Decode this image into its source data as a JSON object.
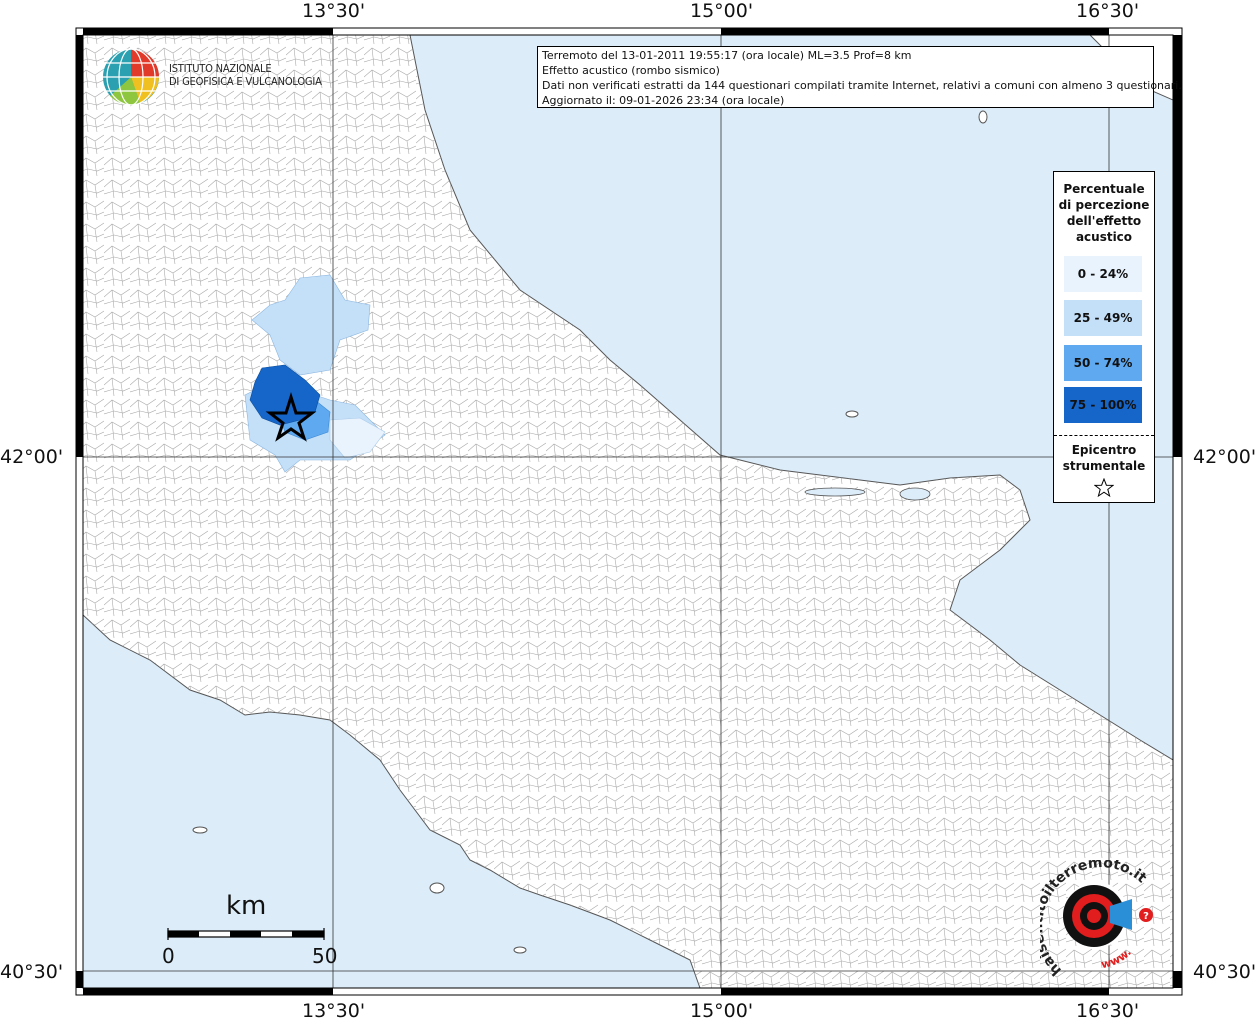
{
  "map": {
    "grid": {
      "lon_labels": [
        "13°30'",
        "15°00'",
        "16°30'"
      ],
      "lat_labels": [
        "42°00'",
        "40°30'"
      ]
    },
    "colors": {
      "sea": "#dcecf9",
      "land": "#ffffff",
      "borders": "#8c8c8c",
      "class_0_24": "#e8f3fd",
      "class_25_49": "#c4dff8",
      "class_50_74": "#5ea9ef",
      "class_75_100": "#1566c8"
    }
  },
  "logo": {
    "line1": "ISTITUTO NAZIONALE",
    "line2": "DI GEOFISICA E VULCANOLOGIA"
  },
  "info": {
    "line1": "Terremoto del 13-01-2011 19:55:17 (ora locale) ML=3.5 Prof=8 km",
    "line2": "Effetto acustico (rombo sismico)",
    "line3": "Dati non verificati estratti da 144 questionari compilati tramite Internet, relativi a comuni con almeno 3 questionari.",
    "line4": "Aggiornato il: 09-01-2026 23:34 (ora locale)"
  },
  "legend": {
    "title_l1": "Percentuale",
    "title_l2": "di percezione",
    "title_l3": "dell'effetto",
    "title_l4": "acustico",
    "classes": [
      "0 - 24%",
      "25 - 49%",
      "50 - 74%",
      "75 - 100%"
    ],
    "epicenter_l1": "Epicentro",
    "epicenter_l2": "strumentale"
  },
  "scalebar": {
    "unit": "km",
    "start": "0",
    "end": "50"
  },
  "sentito": {
    "brand": "haisentitoilterremoto.it",
    "url": "www."
  }
}
